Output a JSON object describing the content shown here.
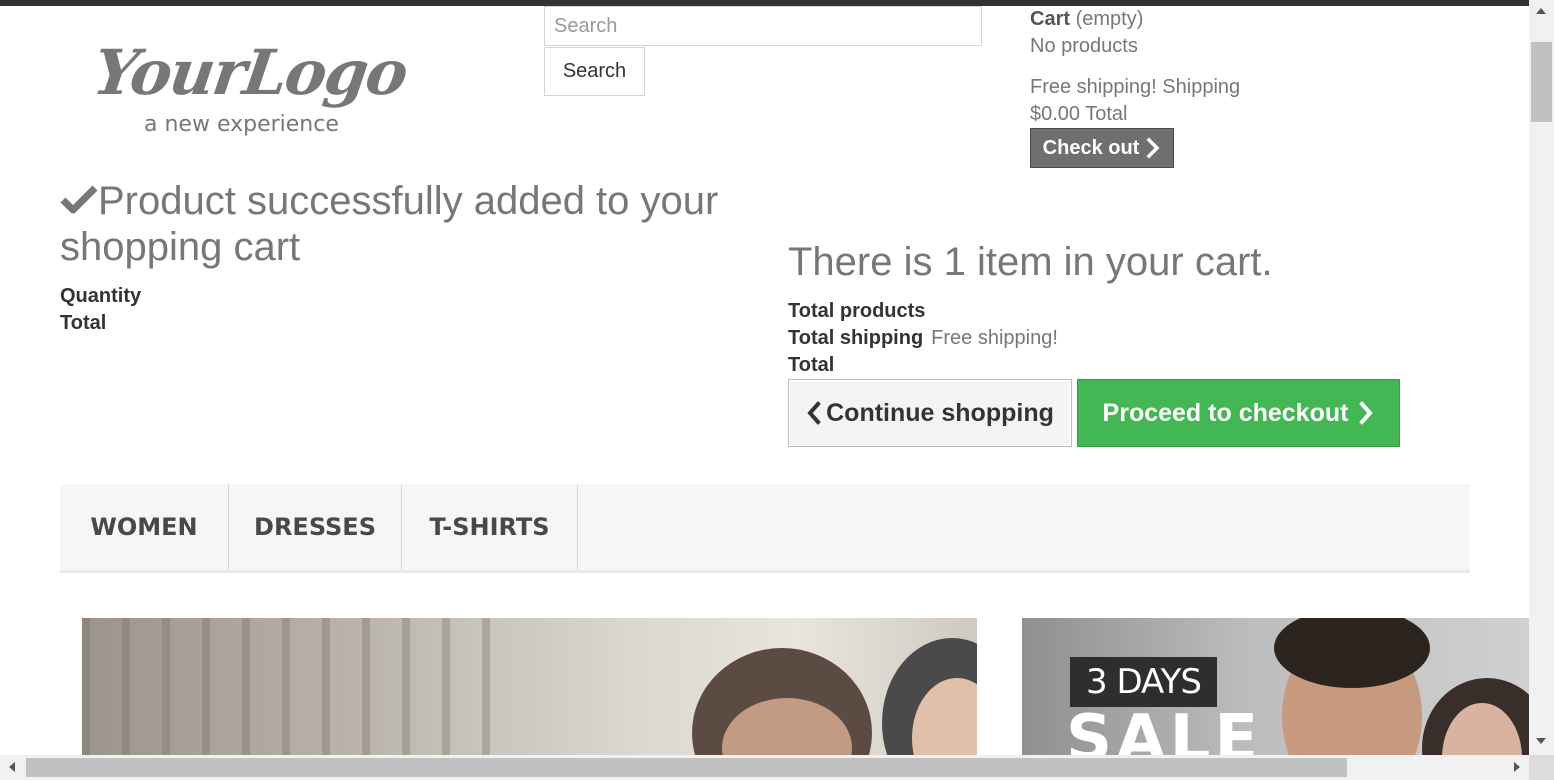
{
  "logo": {
    "main": "YourLogo",
    "tagline": "a new experience"
  },
  "search": {
    "placeholder": "Search",
    "value": "",
    "button_label": "Search"
  },
  "mini_cart": {
    "cart_label": "Cart",
    "cart_state": "(empty)",
    "no_products": "No products",
    "shipping_line": "Free shipping! Shipping",
    "total_line": "$0.00 Total",
    "checkout_label": "Check out"
  },
  "layer_cart": {
    "success_message": "Product successfully added to your shopping cart",
    "quantity_label": "Quantity",
    "total_label": "Total",
    "items_message": "There is 1 item in your cart.",
    "total_products_label": "Total products",
    "total_shipping_label": "Total shipping",
    "total_shipping_value": "Free shipping!",
    "total_label_right": "Total",
    "continue_label": "Continue shopping",
    "proceed_label": "Proceed to checkout"
  },
  "menu": {
    "items": [
      {
        "label": "Women"
      },
      {
        "label": "Dresses"
      },
      {
        "label": "T-shirts"
      }
    ]
  },
  "banners": {
    "right": {
      "badge": "3 DAYS",
      "headline": "SALE"
    }
  },
  "colors": {
    "proceed_green": "#43b754",
    "checkout_gray": "#6f6f6f",
    "text_gray": "#777777"
  },
  "icons": {
    "success": "check-icon",
    "continue": "chevron-left-icon",
    "proceed": "chevron-right-icon",
    "checkout": "chevron-right-icon"
  }
}
